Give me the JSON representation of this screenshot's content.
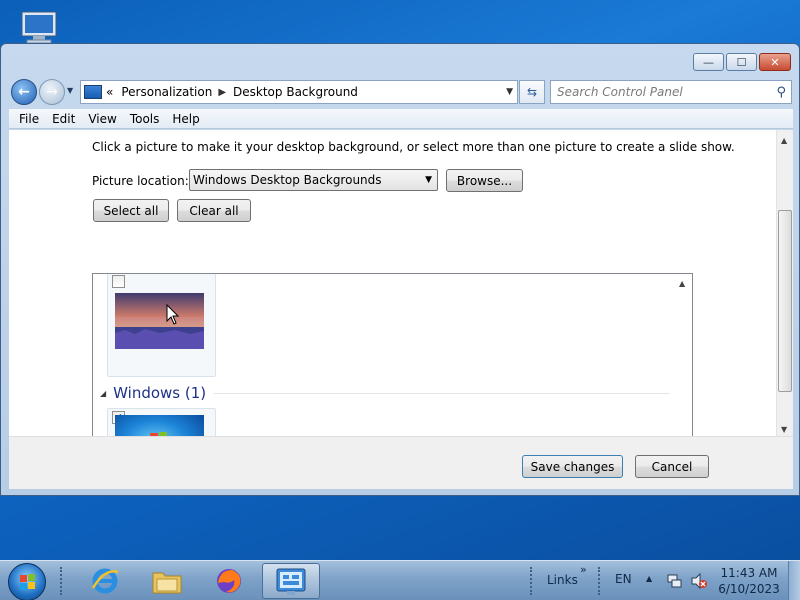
{
  "window": {
    "controls": {
      "minimize": "—",
      "maximize": "☐",
      "close": "✕"
    }
  },
  "nav": {
    "back_glyph": "←",
    "forward_glyph": "→",
    "breadcrumbs": [
      "Personalization",
      "Desktop Background"
    ],
    "overflow_glyph": "«",
    "search_placeholder": "Search Control Panel"
  },
  "menu": [
    "File",
    "Edit",
    "View",
    "Tools",
    "Help"
  ],
  "content": {
    "instruction": "Click a picture to make it your desktop background, or select more than one picture to create a slide show.",
    "location_label": "Picture location:",
    "location_value": "Windows Desktop Backgrounds",
    "browse_label": "Browse...",
    "select_all_label": "Select all",
    "clear_all_label": "Clear all",
    "groups": [
      {
        "name": null,
        "items": [
          {
            "checked": false,
            "icon": "lake-sunset-wallpaper"
          }
        ]
      },
      {
        "name": "Windows (1)",
        "items": [
          {
            "checked": true,
            "icon": "windows7-logo-wallpaper"
          }
        ]
      }
    ]
  },
  "footer": {
    "save_label": "Save changes",
    "cancel_label": "Cancel"
  },
  "taskbar": {
    "pinned": [
      "internet-explorer-icon",
      "file-explorer-icon",
      "firefox-icon",
      "control-panel-icon"
    ],
    "links_label": "Links",
    "links_chevron": "»",
    "language": "EN",
    "time": "11:43 AM",
    "date": "6/10/2023"
  },
  "colors": {
    "accent": "#1e3287",
    "desktop": "#0d63c0"
  }
}
